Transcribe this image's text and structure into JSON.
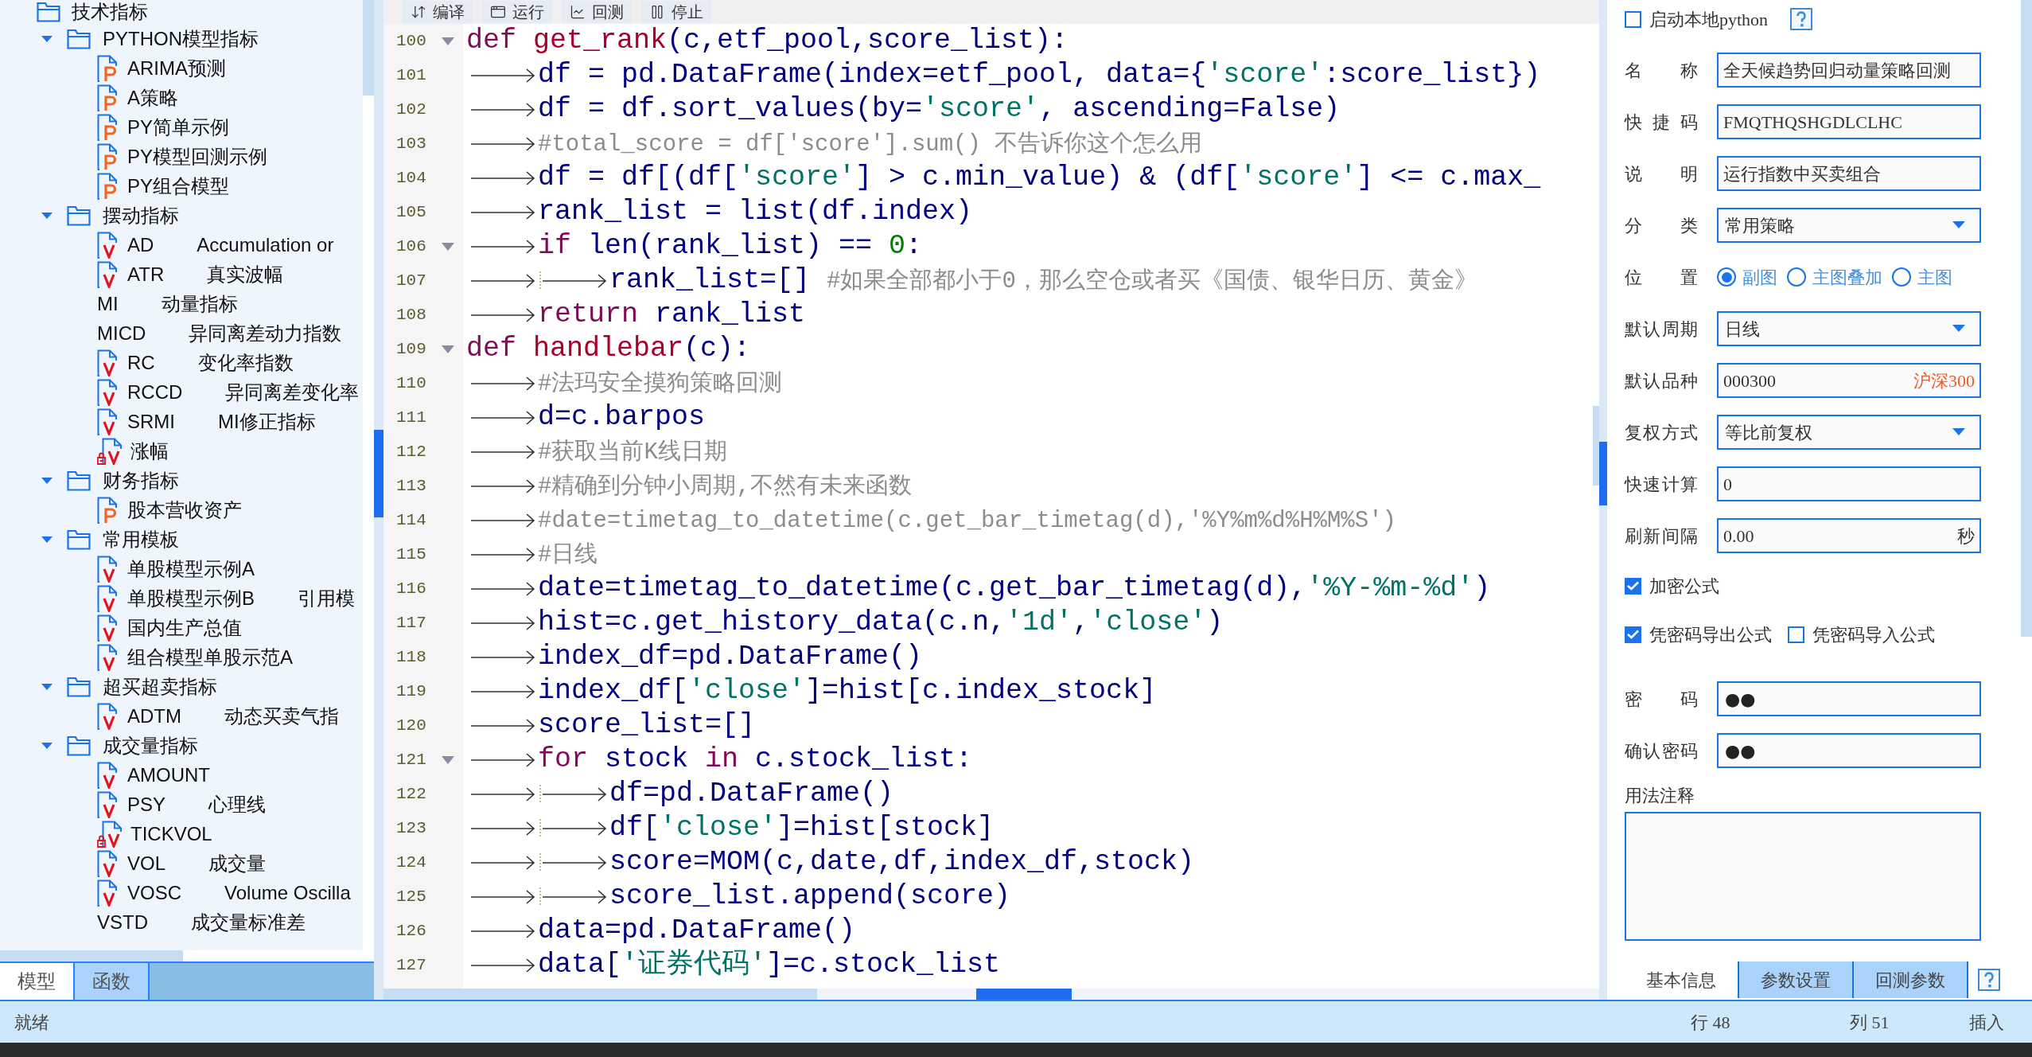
{
  "tree": {
    "root": {
      "label": "技术指标"
    },
    "groups": [
      {
        "label": "PYTHON模型指标",
        "expanded": true,
        "children": [
          {
            "name": "ARIMA预测",
            "kind": "python"
          },
          {
            "name": "A策略",
            "kind": "python"
          },
          {
            "name": "PY简单示例",
            "kind": "python"
          },
          {
            "name": "PY模型回测示例",
            "kind": "python"
          },
          {
            "name": "PY组合模型",
            "kind": "python"
          }
        ]
      },
      {
        "label": "摆动指标",
        "expanded": true,
        "children": [
          {
            "name": "AD",
            "description": "Accumulation or",
            "kind": "formula"
          },
          {
            "name": "ATR",
            "description": "真实波幅",
            "kind": "formula"
          },
          {
            "name": "MI",
            "description": "动量指标",
            "kind": "plain"
          },
          {
            "name": "MICD",
            "description": "异同离差动力指数",
            "kind": "plain"
          },
          {
            "name": "RC",
            "description": "变化率指数",
            "kind": "formula"
          },
          {
            "name": "RCCD",
            "description": "异同离差变化率",
            "kind": "formula"
          },
          {
            "name": "SRMI",
            "description": "MI修正指标",
            "kind": "formula"
          },
          {
            "name": "涨幅",
            "kind": "locked"
          }
        ]
      },
      {
        "label": "财务指标",
        "expanded": true,
        "children": [
          {
            "name": "股本营收资产",
            "kind": "python"
          }
        ]
      },
      {
        "label": "常用模板",
        "expanded": true,
        "children": [
          {
            "name": "单股模型示例A",
            "kind": "formula"
          },
          {
            "name": "单股模型示例B",
            "description": "引用模",
            "kind": "formula"
          },
          {
            "name": "国内生产总值",
            "kind": "formula"
          },
          {
            "name": "组合模型单股示范A",
            "kind": "formula"
          }
        ]
      },
      {
        "label": "超买超卖指标",
        "expanded": true,
        "children": [
          {
            "name": "ADTM",
            "description": "动态买卖气指",
            "kind": "formula"
          }
        ]
      },
      {
        "label": "成交量指标",
        "expanded": true,
        "children": [
          {
            "name": "AMOUNT",
            "kind": "formula"
          },
          {
            "name": "PSY",
            "description": "心理线",
            "kind": "formula"
          },
          {
            "name": "TICKVOL",
            "kind": "locked"
          },
          {
            "name": "VOL",
            "description": "成交量",
            "kind": "formula"
          },
          {
            "name": "VOSC",
            "description": "Volume Oscilla",
            "kind": "formula"
          },
          {
            "name": "VSTD",
            "description": "成交量标准差",
            "kind": "plain"
          }
        ]
      }
    ]
  },
  "left_tabs": [
    {
      "label": "模型",
      "selected": true
    },
    {
      "label": "函数",
      "selected": false
    }
  ],
  "editor_toolbar": [
    {
      "label": "编译",
      "kind": "compile"
    },
    {
      "label": "运行",
      "kind": "run"
    },
    {
      "label": "回测",
      "kind": "backtest"
    },
    {
      "label": "停止",
      "kind": "stop"
    }
  ],
  "code_lines": [
    {
      "number": "100",
      "fold": true,
      "tokens": [
        {
          "kind": "keyword",
          "text": "def "
        },
        {
          "kind": "function",
          "text": "get_rank"
        },
        {
          "kind": "name",
          "text": "(c,etf_pool,score_list):"
        }
      ]
    },
    {
      "number": "101",
      "fold": false,
      "tabs": [
        {
          "kind": "arrow"
        }
      ],
      "tokens": [
        {
          "kind": "name",
          "text": "df = pd.DataFrame(index=etf_pool, data={"
        },
        {
          "kind": "string",
          "text": "'score'"
        },
        {
          "kind": "name",
          "text": ":score_list})"
        }
      ]
    },
    {
      "number": "102",
      "fold": false,
      "tabs": [
        {
          "kind": "arrow"
        }
      ],
      "tokens": [
        {
          "kind": "name",
          "text": "df = df.sort_values(by="
        },
        {
          "kind": "string",
          "text": "'score'"
        },
        {
          "kind": "name",
          "text": ", ascending=False)"
        }
      ]
    },
    {
      "number": "103",
      "fold": false,
      "tabs": [
        {
          "kind": "arrow"
        }
      ],
      "tokens": [
        {
          "kind": "comment",
          "text": "#total_score = df['score'].sum() 不告诉你这个怎么用"
        }
      ]
    },
    {
      "number": "104",
      "fold": false,
      "tabs": [
        {
          "kind": "arrow"
        }
      ],
      "tokens": [
        {
          "kind": "name",
          "text": "df = df[(df["
        },
        {
          "kind": "string",
          "text": "'score'"
        },
        {
          "kind": "name",
          "text": "] > c.min_value) & (df["
        },
        {
          "kind": "string",
          "text": "'score'"
        },
        {
          "kind": "name",
          "text": "] <= c.max_"
        }
      ]
    },
    {
      "number": "105",
      "fold": false,
      "tabs": [
        {
          "kind": "arrow"
        }
      ],
      "tokens": [
        {
          "kind": "name",
          "text": "rank_list = list(df.index)"
        }
      ]
    },
    {
      "number": "106",
      "fold": true,
      "tabs": [
        {
          "kind": "arrow"
        }
      ],
      "tokens": [
        {
          "kind": "keyword",
          "text": "if"
        },
        {
          "kind": "name",
          "text": " len(rank_list) == "
        },
        {
          "kind": "number",
          "text": "0"
        },
        {
          "kind": "name",
          "text": ":"
        }
      ]
    },
    {
      "number": "107",
      "fold": false,
      "tabs": [
        {
          "kind": "arrow"
        },
        {
          "kind": "arrow"
        }
      ],
      "tokens": [
        {
          "kind": "name",
          "text": "rank_list=[] "
        },
        {
          "kind": "comment",
          "text": "#如果全部都小于0，那么空仓或者买《国债、银华日历、黄金》"
        }
      ]
    },
    {
      "number": "108",
      "fold": false,
      "tabs": [
        {
          "kind": "arrow"
        }
      ],
      "tokens": [
        {
          "kind": "keyword",
          "text": "return"
        },
        {
          "kind": "name",
          "text": " rank_list"
        }
      ]
    },
    {
      "number": "109",
      "fold": true,
      "tokens": [
        {
          "kind": "keyword",
          "text": "def "
        },
        {
          "kind": "function",
          "text": "handlebar"
        },
        {
          "kind": "name",
          "text": "(c):"
        }
      ]
    },
    {
      "number": "110",
      "fold": false,
      "tabs": [
        {
          "kind": "arrow"
        }
      ],
      "tokens": [
        {
          "kind": "comment",
          "text": "#法玛安全摸狗策略回测"
        }
      ]
    },
    {
      "number": "111",
      "fold": false,
      "tabs": [
        {
          "kind": "arrow"
        }
      ],
      "tokens": [
        {
          "kind": "name",
          "text": "d=c.barpos"
        }
      ]
    },
    {
      "number": "112",
      "fold": false,
      "tabs": [
        {
          "kind": "arrow"
        }
      ],
      "tokens": [
        {
          "kind": "comment",
          "text": "#获取当前K线日期"
        }
      ]
    },
    {
      "number": "113",
      "fold": false,
      "tabs": [
        {
          "kind": "arrow"
        }
      ],
      "tokens": [
        {
          "kind": "comment",
          "text": "#精确到分钟小周期,不然有未来函数"
        }
      ]
    },
    {
      "number": "114",
      "fold": false,
      "tabs": [
        {
          "kind": "arrow"
        }
      ],
      "tokens": [
        {
          "kind": "comment",
          "text": "#date=timetag_to_datetime(c.get_bar_timetag(d),'%Y%m%d%H%M%S')"
        }
      ]
    },
    {
      "number": "115",
      "fold": false,
      "tabs": [
        {
          "kind": "arrow"
        }
      ],
      "tokens": [
        {
          "kind": "comment",
          "text": "#日线"
        }
      ]
    },
    {
      "number": "116",
      "fold": false,
      "tabs": [
        {
          "kind": "arrow"
        }
      ],
      "tokens": [
        {
          "kind": "name",
          "text": "date=timetag_to_datetime(c.get_bar_timetag(d),"
        },
        {
          "kind": "string",
          "text": "'%Y-%m-%d'"
        },
        {
          "kind": "name",
          "text": ")"
        }
      ]
    },
    {
      "number": "117",
      "fold": false,
      "tabs": [
        {
          "kind": "arrow"
        }
      ],
      "tokens": [
        {
          "kind": "name",
          "text": "hist=c.get_history_data(c.n,"
        },
        {
          "kind": "string",
          "text": "'1d'"
        },
        {
          "kind": "name",
          "text": ","
        },
        {
          "kind": "string",
          "text": "'close'"
        },
        {
          "kind": "name",
          "text": ")"
        }
      ]
    },
    {
      "number": "118",
      "fold": false,
      "tabs": [
        {
          "kind": "arrow"
        }
      ],
      "tokens": [
        {
          "kind": "name",
          "text": "index_df=pd.DataFrame()"
        }
      ]
    },
    {
      "number": "119",
      "fold": false,
      "tabs": [
        {
          "kind": "arrow"
        }
      ],
      "tokens": [
        {
          "kind": "name",
          "text": "index_df["
        },
        {
          "kind": "string",
          "text": "'close'"
        },
        {
          "kind": "name",
          "text": "]=hist[c.index_stock]"
        }
      ]
    },
    {
      "number": "120",
      "fold": false,
      "tabs": [
        {
          "kind": "arrow"
        }
      ],
      "tokens": [
        {
          "kind": "name",
          "text": "score_list=[]"
        }
      ]
    },
    {
      "number": "121",
      "fold": true,
      "tabs": [
        {
          "kind": "arrow"
        }
      ],
      "tokens": [
        {
          "kind": "keyword",
          "text": "for"
        },
        {
          "kind": "name",
          "text": " stock "
        },
        {
          "kind": "keyword",
          "text": "in"
        },
        {
          "kind": "name",
          "text": " c.stock_list:"
        }
      ]
    },
    {
      "number": "122",
      "fold": false,
      "tabs": [
        {
          "kind": "arrow"
        },
        {
          "kind": "arrow"
        }
      ],
      "tokens": [
        {
          "kind": "name",
          "text": "df=pd.DataFrame()"
        }
      ]
    },
    {
      "number": "123",
      "fold": false,
      "tabs": [
        {
          "kind": "arrow"
        },
        {
          "kind": "arrow"
        }
      ],
      "tokens": [
        {
          "kind": "name",
          "text": "df["
        },
        {
          "kind": "string",
          "text": "'close'"
        },
        {
          "kind": "name",
          "text": "]=hist[stock]"
        }
      ]
    },
    {
      "number": "124",
      "fold": false,
      "tabs": [
        {
          "kind": "arrow"
        },
        {
          "kind": "arrow"
        }
      ],
      "tokens": [
        {
          "kind": "name",
          "text": "score=MOM(c,date,df,index_df,stock)"
        }
      ]
    },
    {
      "number": "125",
      "fold": false,
      "tabs": [
        {
          "kind": "arrow"
        },
        {
          "kind": "arrow"
        }
      ],
      "tokens": [
        {
          "kind": "name",
          "text": "score_list.append(score)"
        }
      ]
    },
    {
      "number": "126",
      "fold": false,
      "tabs": [
        {
          "kind": "arrow"
        }
      ],
      "tokens": [
        {
          "kind": "name",
          "text": "data=pd.DataFrame()"
        }
      ]
    },
    {
      "number": "127",
      "fold": false,
      "tabs": [
        {
          "kind": "arrow"
        }
      ],
      "tokens": [
        {
          "kind": "name",
          "text": "data["
        },
        {
          "kind": "string",
          "text": "'证券代码'"
        },
        {
          "kind": "name",
          "text": "]=c.stock_list"
        }
      ]
    }
  ],
  "properties": {
    "local_python": {
      "label": "启动本地python",
      "checked": false
    },
    "fields": [
      {
        "kind": "text",
        "label": "名称",
        "value": "全天候趋势回归动量策略回测"
      },
      {
        "kind": "text",
        "label": "快捷码",
        "value": "FMQTHQSHGDLCLHC"
      },
      {
        "kind": "text",
        "label": "说明",
        "value": "运行指数中买卖组合"
      },
      {
        "kind": "select",
        "label": "分类",
        "value": "常用策略"
      },
      {
        "kind": "radio",
        "label": "位置",
        "options": [
          {
            "label": "副图",
            "selected": true
          },
          {
            "label": "主图叠加",
            "selected": false
          },
          {
            "label": "主图",
            "selected": false
          }
        ]
      },
      {
        "kind": "select",
        "label": "默认周期",
        "value": "日线"
      },
      {
        "kind": "text",
        "label": "默认品种",
        "value": "000300",
        "suffix": "沪深300"
      },
      {
        "kind": "select",
        "label": "复权方式",
        "value": "等比前复权"
      },
      {
        "kind": "text",
        "label": "快速计算",
        "value": "0"
      },
      {
        "kind": "text",
        "label": "刷新间隔",
        "value": "0.00",
        "suffix": "秒"
      }
    ],
    "encrypt": {
      "label": "加密公式",
      "checked": true
    },
    "export_options": [
      {
        "label": "凭密码导出公式",
        "checked": true
      },
      {
        "label": "凭密码导入公式",
        "checked": false
      }
    ],
    "password_fields": [
      {
        "label": "密码",
        "value": "●●"
      },
      {
        "label": "确认密码",
        "value": "●●"
      }
    ],
    "notes_label": "用法注释",
    "tabs": [
      {
        "label": "基本信息",
        "selected": true
      },
      {
        "label": "参数设置",
        "selected": false
      },
      {
        "label": "回测参数",
        "selected": false
      }
    ]
  },
  "status_bar": {
    "state": "就绪",
    "row": "行 48",
    "column": "列 51",
    "mode": "插入"
  }
}
